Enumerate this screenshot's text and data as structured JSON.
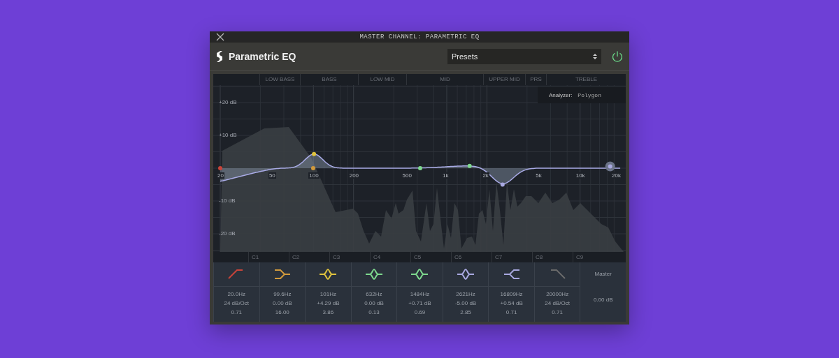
{
  "window": {
    "title": "MASTER CHANNEL: PARAMETRIC EQ"
  },
  "header": {
    "title": "Parametric EQ",
    "presets": "Presets",
    "power": {
      "on": true
    }
  },
  "graph": {
    "bands": [
      "LOW BASS",
      "BASS",
      "LOW MID",
      "MID",
      "UPPER MID",
      "PRS",
      "TREBLE"
    ],
    "analyzer": {
      "label": "Analyzer:",
      "value": "Polygon"
    },
    "y_labels": [
      "+20 dB",
      "+10 dB",
      "-10 dB",
      "-20 dB"
    ],
    "x_labels": [
      "20",
      "50",
      "100",
      "200",
      "500",
      "1k",
      "2k",
      "5k",
      "10k",
      "20k"
    ],
    "channels": [
      "C1",
      "C2",
      "C3",
      "C4",
      "C5",
      "C6",
      "C7",
      "C8",
      "C9"
    ]
  },
  "filters": [
    {
      "kind": "lowcut",
      "color": "#c8443a",
      "frequency": "20.0Hz",
      "gain": "24 dB/Oct",
      "q": "0.71"
    },
    {
      "kind": "lowshelf",
      "color": "#d29a3c",
      "frequency": "99.6Hz",
      "gain": "0.00 dB",
      "q": "16.00"
    },
    {
      "kind": "bell",
      "color": "#e0c33e",
      "frequency": "101Hz",
      "gain": "+4.29 dB",
      "q": "3.86"
    },
    {
      "kind": "bell",
      "color": "#7ed88e",
      "frequency": "632Hz",
      "gain": "0.00 dB",
      "q": "0.13"
    },
    {
      "kind": "bell",
      "color": "#7ed88e",
      "frequency": "1484Hz",
      "gain": "+0.71 dB",
      "q": "0.69"
    },
    {
      "kind": "bell",
      "color": "#a8a8e0",
      "frequency": "2621Hz",
      "gain": "-5.00 dB",
      "q": "2.85"
    },
    {
      "kind": "highshelf",
      "color": "#a8a8e0",
      "frequency": "16809Hz",
      "gain": "+0.54 dB",
      "q": "0.71"
    },
    {
      "kind": "highcut",
      "color": "#6a6a6a",
      "frequency": "20000Hz",
      "gain": "24 dB/Oct",
      "q": "0.71"
    }
  ],
  "master": {
    "label": "Master",
    "gain": "0.00 dB"
  }
}
